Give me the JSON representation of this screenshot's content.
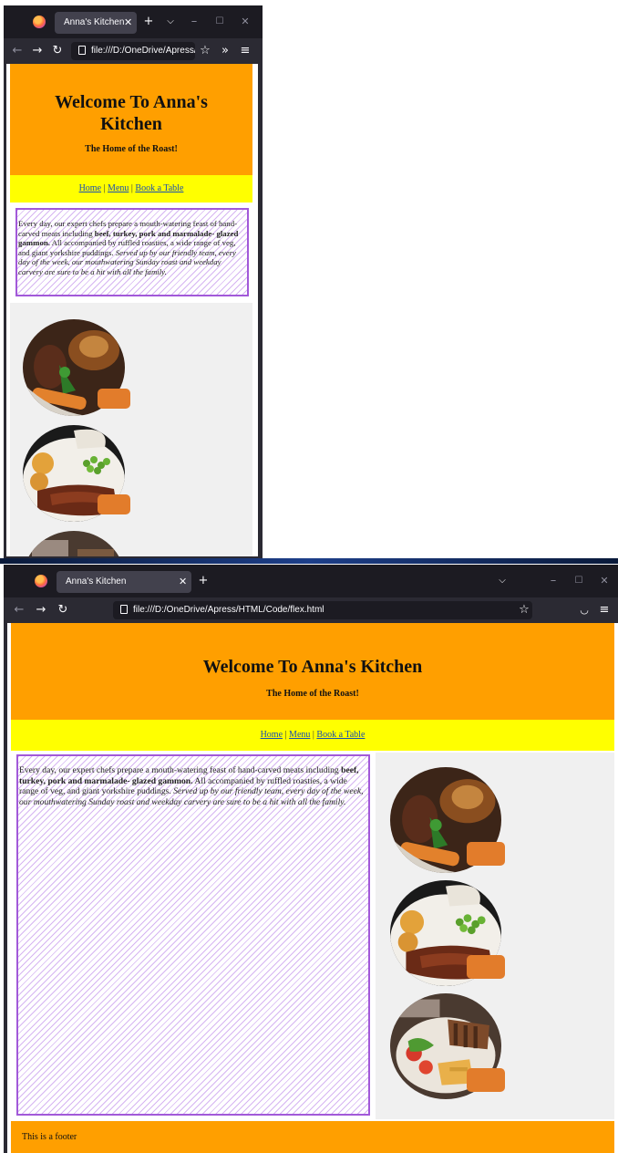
{
  "browser": {
    "tab_title": "Anna's Kitchen",
    "url_small": "file:///D:/OneDrive/Apress/HTML",
    "url_large": "file:///D:/OneDrive/Apress/HTML/Code/flex.html",
    "icons": [
      "firefox-logo",
      "close-icon",
      "plus-icon",
      "chevron-down-icon",
      "minimize-icon",
      "maximize-icon",
      "back-icon",
      "forward-icon",
      "reload-icon",
      "page-icon",
      "star-icon",
      "overflow-icon",
      "pocket-icon",
      "menu-icon"
    ]
  },
  "page": {
    "title_line": "Welcome To Anna's Kitchen",
    "title_part1": "Welcome To Anna's",
    "title_part2": "Kitchen",
    "tagline": "The Home of the Roast!",
    "nav": {
      "home": "Home",
      "menu": "Menu",
      "book": "Book a Table",
      "separator": "|"
    },
    "intro": {
      "lead": "Every day, our expert chefs prepare a mouth-watering feast of hand-carved meats including",
      "bold": "beef, turkey, pork and marmalade- glazed gammon.",
      "middle": "All accompanied by ruffled roasties, a wide range of veg, and giant yorkshire puddings.",
      "italic": "Served up by our friendly team, every day of the week, our mouthwatering Sunday roast and weekday carvery are sure to be a hit with all the family."
    },
    "footer": "This is a footer"
  },
  "colors": {
    "header": "#ff9f00",
    "nav": "#ffff00",
    "hatch_border": "#a259d9",
    "badge": "#e27c2b",
    "chrome": "#2b2a33"
  }
}
